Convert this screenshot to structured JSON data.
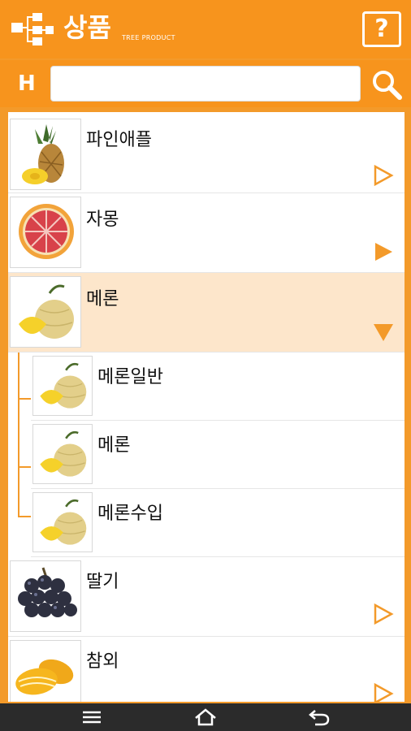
{
  "header": {
    "title": "상품",
    "subtitle": "TREE PRODUCT",
    "help_label": "?"
  },
  "search": {
    "prefix": "H",
    "value": "",
    "placeholder": ""
  },
  "list": {
    "items": [
      {
        "label": "파인애플",
        "fruit": "pineapple",
        "state": "collapsed"
      },
      {
        "label": "자몽",
        "fruit": "grapefruit",
        "state": "collapsed-selected"
      },
      {
        "label": "메론",
        "fruit": "melon",
        "state": "expanded",
        "children": [
          {
            "label": "메론일반",
            "fruit": "melon"
          },
          {
            "label": "메론",
            "fruit": "melon"
          },
          {
            "label": "메론수입",
            "fruit": "melon"
          }
        ]
      },
      {
        "label": "딸기",
        "fruit": "grapes",
        "state": "collapsed"
      },
      {
        "label": "참외",
        "fruit": "korean-melon",
        "state": "collapsed"
      }
    ]
  },
  "colors": {
    "accent": "#f7941d",
    "expanded_bg": "#fde6cb",
    "navbar": "#2b2b2b"
  },
  "navbar": {
    "icons": [
      "menu-icon",
      "home-icon",
      "back-icon"
    ]
  }
}
